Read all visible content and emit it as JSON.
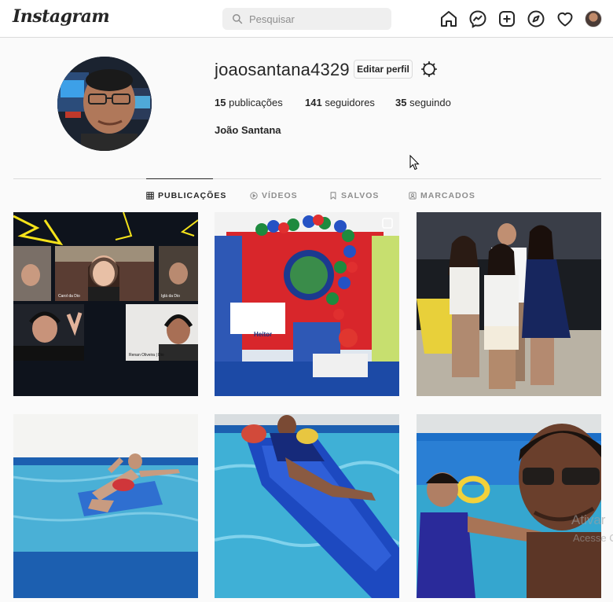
{
  "nav": {
    "logo": "Instagram",
    "search_placeholder": "Pesquisar",
    "icons": [
      "home-icon",
      "messenger-icon",
      "new-post-icon",
      "explore-icon",
      "activity-heart-icon",
      "profile-avatar"
    ]
  },
  "profile": {
    "username": "joaosantana4329",
    "edit_label": "Editar perfil",
    "posts_count": "15",
    "posts_label": "publicações",
    "followers_count": "141",
    "followers_label": "seguidores",
    "following_count": "35",
    "following_label": "seguindo",
    "full_name": "João Santana"
  },
  "tabs": [
    {
      "label": "PUBLICAÇÕES",
      "icon": "grid-icon",
      "active": true
    },
    {
      "label": "VÍDEOS",
      "icon": "play-icon",
      "active": false
    },
    {
      "label": "SALVOS",
      "icon": "bookmark-icon",
      "active": false
    },
    {
      "label": "MARCADOS",
      "icon": "tag-person-icon",
      "active": false
    }
  ],
  "posts": [
    {
      "desc": "video-call-collage",
      "names": [
        "Carol da Dio",
        "Iglá da Dio",
        "Renan Oliveira | Dio"
      ]
    },
    {
      "desc": "party-decoration",
      "labels": [
        "Heitor"
      ],
      "multi": true
    },
    {
      "desc": "family-photo-night"
    },
    {
      "desc": "man-floating-in-pool"
    },
    {
      "desc": "woman-on-pool-float"
    },
    {
      "desc": "selfie-with-child-pool"
    }
  ],
  "watermark": {
    "line1": "Ativar",
    "line2": "Acesse C"
  },
  "colors": {
    "border": "#dbdbdb",
    "text": "#262626",
    "muted": "#8e8e8e",
    "bg": "#fafafa"
  }
}
